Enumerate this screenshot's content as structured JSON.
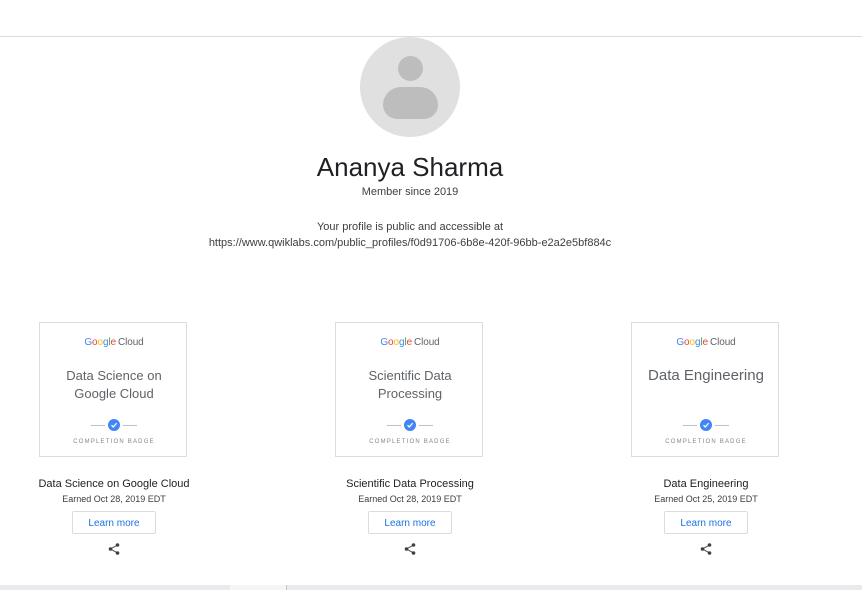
{
  "profile": {
    "name": "Ananya Sharma",
    "member_since": "Member since 2019",
    "public_text": "Your profile is public and accessible at",
    "public_url": "https://www.qwiklabs.com/public_profiles/f0d91706-6b8e-420f-96bb-e2a2e5bf884c"
  },
  "badges": [
    {
      "logo_google": "Google",
      "logo_cloud": "Cloud",
      "card_title": "Data Science on Google Cloud",
      "completion": "COMPLETION BADGE",
      "name": "Data Science on Google Cloud",
      "earned": "Earned Oct 28, 2019 EDT",
      "learn_more": "Learn more"
    },
    {
      "logo_google": "Google",
      "logo_cloud": "Cloud",
      "card_title": "Scientific Data Processing",
      "completion": "COMPLETION BADGE",
      "name": "Scientific Data Processing",
      "earned": "Earned Oct 28, 2019 EDT",
      "learn_more": "Learn more"
    },
    {
      "logo_google": "Google",
      "logo_cloud": "Cloud",
      "card_title": "Data Engineering",
      "completion": "COMPLETION BADGE",
      "name": "Data Engineering",
      "earned": "Earned Oct 25, 2019 EDT",
      "learn_more": "Learn more"
    }
  ],
  "icons": {
    "avatar": "avatar-placeholder-icon",
    "share": "share-icon",
    "check": "check-icon"
  },
  "colors": {
    "accent": "#1a73e8",
    "check": "#4285f4",
    "border": "#dadce0"
  }
}
